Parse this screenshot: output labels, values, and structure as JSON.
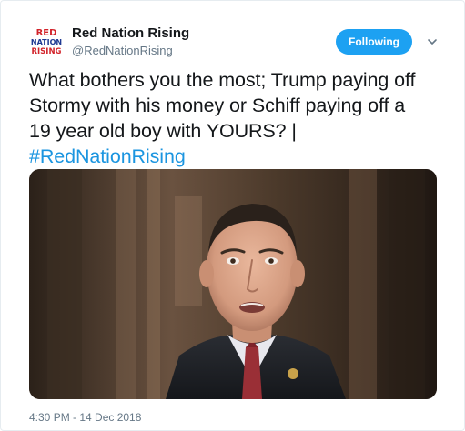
{
  "account": {
    "display_name": "Red Nation Rising",
    "handle": "@RedNationRising",
    "avatar_text": [
      "RED",
      "NATION",
      "RISING"
    ]
  },
  "follow_button": {
    "label": "Following"
  },
  "menu": {
    "icon": "chevron-down-icon"
  },
  "tweet": {
    "lines": [
      "What bothers you the most; Trump paying off",
      "Stormy with his money or Schiff paying off a",
      "19 year old boy with YOURS? |"
    ],
    "hashtag": "#RedNationRising"
  },
  "media": {
    "description_icon": "photo-of-man-in-suit"
  },
  "timestamp": "4:30 PM - 14 Dec 2018",
  "colors": {
    "accent": "#1da1f2",
    "link": "#1b95e0",
    "text": "#14171a",
    "muted": "#657786",
    "logo_red": "#d2232a",
    "logo_blue": "#1f3a93"
  }
}
